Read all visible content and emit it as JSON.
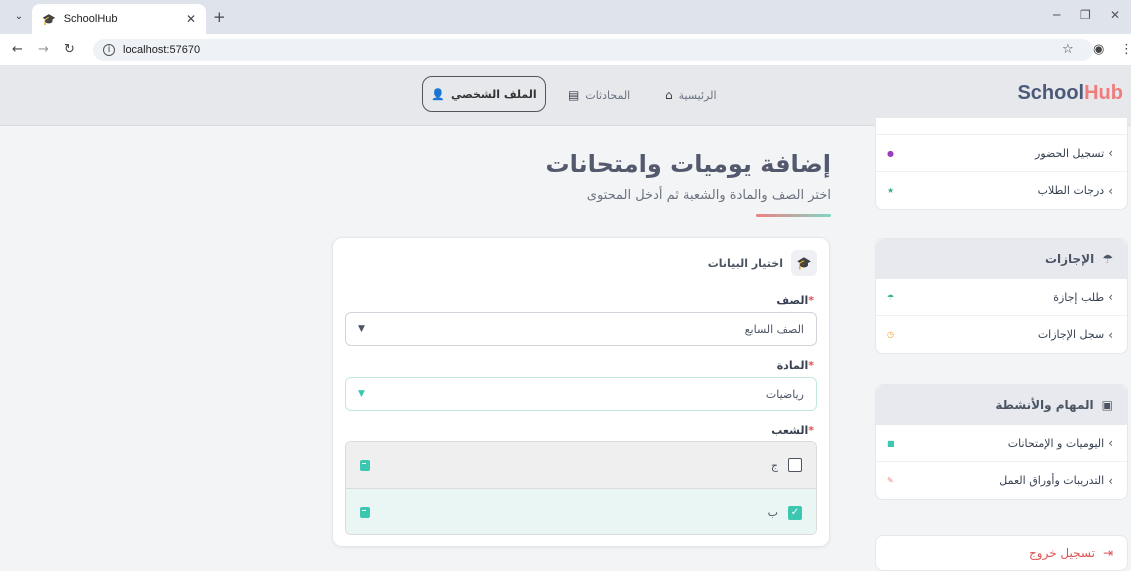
{
  "browser": {
    "tab_title": "SchoolHub",
    "url": "localhost:57670"
  },
  "header": {
    "logo_part1": "School",
    "logo_part2": "Hub",
    "nav": {
      "home": "الرئيسية",
      "chats": "المحادثات",
      "profile": "الملف الشخصي"
    }
  },
  "sidebar": {
    "group1_items": [
      {
        "label": "تسجيل الحضور",
        "color": "#9b3fc2"
      },
      {
        "label": "درجات الطلاب",
        "color": "#36b37e"
      }
    ],
    "leaves": {
      "title": "الإجازات",
      "items": [
        {
          "label": "طلب إجازة",
          "color": "#36b37e"
        },
        {
          "label": "سجل الإجازات",
          "color": "#f0a23b"
        }
      ]
    },
    "tasks": {
      "title": "المهام والأنشطة",
      "items": [
        {
          "label": "اليوميات و الإمتحانات",
          "color": "#3cc7b0"
        },
        {
          "label": "التدريبات وأوراق العمل",
          "color": "#ef7d7d"
        }
      ]
    },
    "logout": "تسجيل خروج"
  },
  "main": {
    "title": "إضافة يوميات وامتحانات",
    "subtitle": "اختر الصف والمادة والشعبة ثم أدخل المحتوى",
    "card": {
      "title": "اختيار البيانات",
      "class_label": "الصف",
      "class_value": "الصف السابع",
      "subject_label": "المادة",
      "subject_value": "رياضيات",
      "sections_label": "الشعب",
      "sections": [
        {
          "name": "ج",
          "checked": false
        },
        {
          "name": "ب",
          "checked": true
        }
      ]
    }
  }
}
